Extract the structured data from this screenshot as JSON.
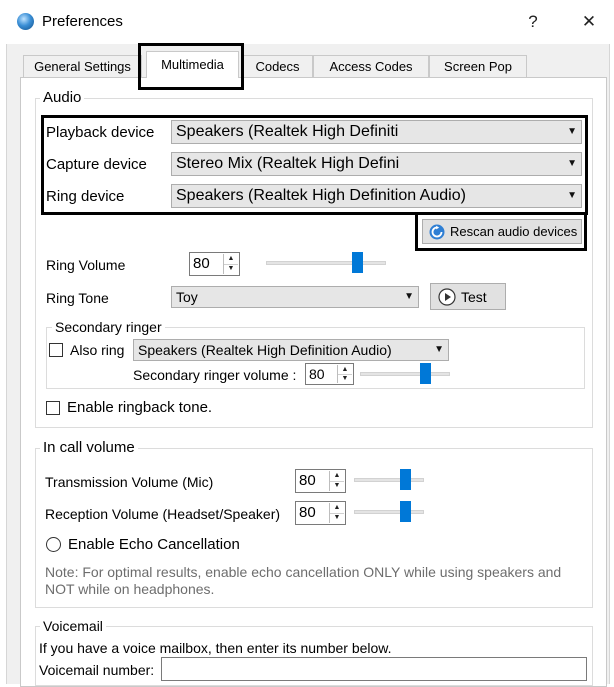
{
  "window": {
    "title": "Preferences",
    "help_label": "?",
    "close_label": "✕"
  },
  "tabs": [
    {
      "label": "General Settings"
    },
    {
      "label": "Multimedia"
    },
    {
      "label": "Codecs"
    },
    {
      "label": "Access Codes"
    },
    {
      "label": "Screen Pop"
    }
  ],
  "audio": {
    "legend": "Audio",
    "playback_label": "Playback device",
    "playback_value": "Speakers (Realtek High Definiti",
    "capture_label": "Capture device",
    "capture_value": "Stereo Mix (Realtek High Defini",
    "ring_label": "Ring device",
    "ring_value": "Speakers (Realtek High Definition Audio)",
    "rescan_label": "Rescan audio devices",
    "ring_volume_label": "Ring Volume",
    "ring_volume_value": "80",
    "ring_tone_label": "Ring Tone",
    "ring_tone_value": "Toy",
    "test_label": "Test",
    "secondary_legend": "Secondary ringer",
    "also_ring_label": "Also ring",
    "also_ring_checked": false,
    "secondary_device_value": "Speakers (Realtek High Definition Audio)",
    "secondary_volume_label": "Secondary ringer volume :",
    "secondary_volume_value": "80",
    "ringback_label": "Enable ringback tone.",
    "ringback_checked": false
  },
  "in_call": {
    "legend": "In call volume",
    "transmission_label": "Transmission Volume (Mic)",
    "transmission_value": "80",
    "reception_label": "Reception Volume (Headset/Speaker)",
    "reception_value": "80",
    "echo_label": "Enable Echo Cancellation",
    "echo_checked": false,
    "note": "Note: For optimal results, enable echo cancellation ONLY while using speakers and NOT while on headphones."
  },
  "voicemail": {
    "legend": "Voicemail",
    "description": "If you have a voice mailbox, then enter its number below.",
    "number_label": "Voicemail number:",
    "number_value": ""
  },
  "colors": {
    "accent": "#0078d7",
    "highlight": "#000000",
    "note": "#6d6d6d"
  }
}
